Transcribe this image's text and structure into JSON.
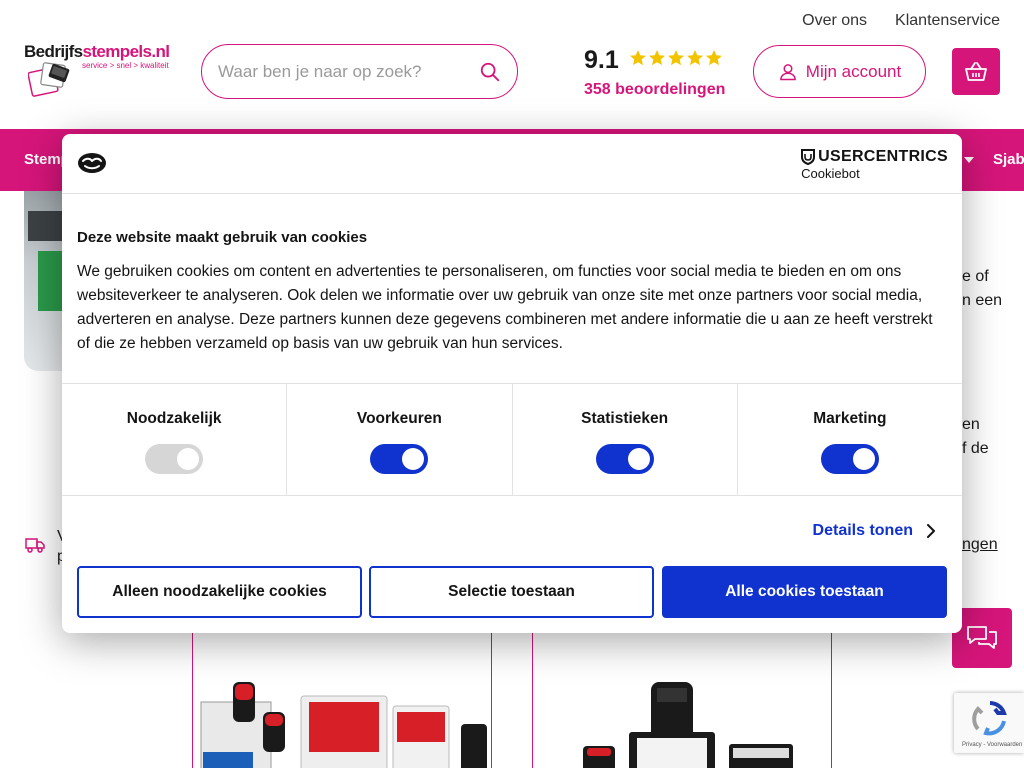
{
  "header": {
    "top_links": [
      "Over ons",
      "Klantenservice"
    ],
    "logo": {
      "name_part1": "Bedrijfs",
      "name_part2": "stempels.nl",
      "tagline": "service > snel > kwaliteit"
    },
    "search": {
      "placeholder": "Waar ben je naar op zoek?"
    },
    "rating": {
      "score": "9.1",
      "stars": 5,
      "count_label": "358 beoordelingen"
    },
    "account_label": "Mijn account"
  },
  "nav": {
    "left_item": "Stemp",
    "right_item": "Sjab"
  },
  "background": {
    "side_text_1": [
      "e of",
      "n een"
    ],
    "side_text_2": [
      "en",
      "f de"
    ],
    "side_link": "ngen",
    "usp_text": [
      "V",
      "p"
    ]
  },
  "cookie_dialog": {
    "brand": "USERCENTRICS",
    "brand_sub": "Cookiebot",
    "title": "Deze website maakt gebruik van cookies",
    "body": "We gebruiken cookies om content en advertenties te personaliseren, om functies voor social media te bieden en om ons websiteverkeer te analyseren. Ook delen we informatie over uw gebruik van onze site met onze partners voor social media, adverteren en analyse. Deze partners kunnen deze gegevens combineren met andere informatie die u aan ze heeft verstrekt of die ze hebben verzameld op basis van uw gebruik van hun services.",
    "categories": [
      {
        "label": "Noodzakelijk",
        "enabled": true,
        "locked": true
      },
      {
        "label": "Voorkeuren",
        "enabled": true,
        "locked": false
      },
      {
        "label": "Statistieken",
        "enabled": true,
        "locked": false
      },
      {
        "label": "Marketing",
        "enabled": true,
        "locked": false
      }
    ],
    "details_label": "Details tonen",
    "buttons": {
      "necessary_only": "Alleen noodzakelijke cookies",
      "allow_selection": "Selectie toestaan",
      "allow_all": "Alle cookies toestaan"
    }
  },
  "recaptcha": {
    "legal": "Privacy - Voorwaarden"
  },
  "colors": {
    "brand": "#d6157a",
    "consent_blue": "#1032cf",
    "star": "#f2c400"
  }
}
